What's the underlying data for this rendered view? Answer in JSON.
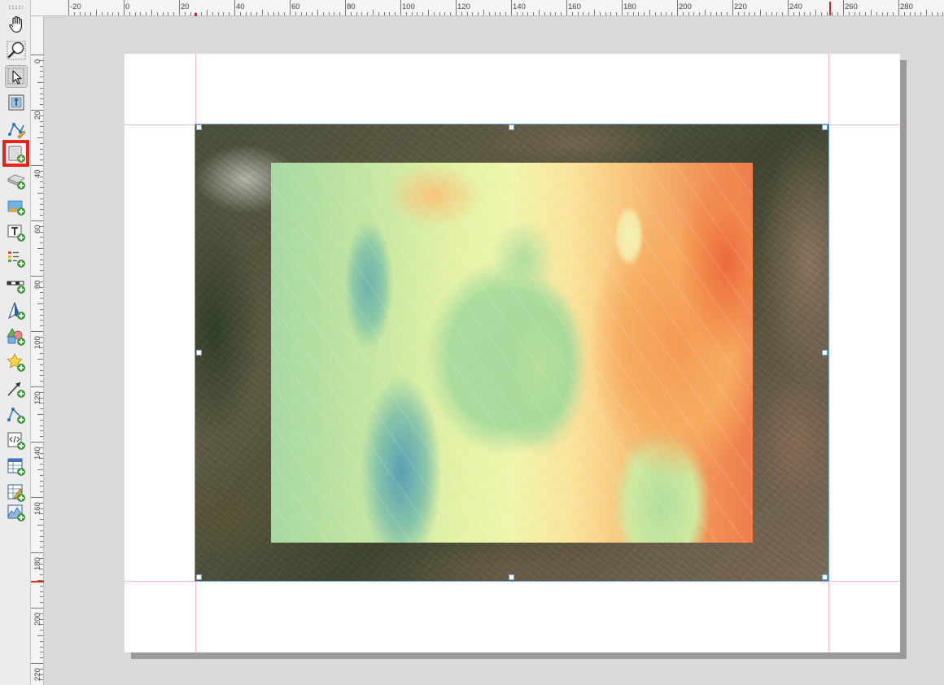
{
  "window": {
    "app": "Print layout designer"
  },
  "toolbar": {
    "tools": [
      {
        "id": "pan",
        "icon": "hand-pan-icon",
        "tooltip": "Pan Layout"
      },
      {
        "id": "zoom",
        "icon": "zoom-magnifier-icon",
        "tooltip": "Zoom"
      },
      {
        "id": "select",
        "icon": "select-move-arrow-icon",
        "tooltip": "Select/Move Item",
        "active": true
      },
      {
        "id": "move-content",
        "icon": "move-item-content-icon",
        "tooltip": "Move Item Content"
      },
      {
        "id": "edit-nodes",
        "icon": "edit-nodes-icon",
        "tooltip": "Edit Nodes Item"
      },
      {
        "id": "add-map",
        "icon": "add-map-icon",
        "tooltip": "Add Map",
        "highlighted": true
      },
      {
        "id": "add-3d-map",
        "icon": "add-3d-map-icon",
        "tooltip": "Add 3D Map"
      },
      {
        "id": "add-picture",
        "icon": "add-picture-icon",
        "tooltip": "Add Picture"
      },
      {
        "id": "add-label",
        "icon": "add-label-icon",
        "tooltip": "Add Label"
      },
      {
        "id": "add-legend",
        "icon": "add-legend-icon",
        "tooltip": "Add Legend"
      },
      {
        "id": "add-scale-bar",
        "icon": "add-scale-bar-icon",
        "tooltip": "Add Scale Bar"
      },
      {
        "id": "add-north-arrow",
        "icon": "add-north-arrow-icon",
        "tooltip": "Add North Arrow"
      },
      {
        "id": "add-shape",
        "icon": "add-shape-icon",
        "tooltip": "Add Shape"
      },
      {
        "id": "add-marker",
        "icon": "add-marker-star-icon",
        "tooltip": "Add Marker"
      },
      {
        "id": "add-arrow",
        "icon": "add-arrow-icon",
        "tooltip": "Add Arrow"
      },
      {
        "id": "add-node-item",
        "icon": "add-node-item-icon",
        "tooltip": "Add Node Item"
      },
      {
        "id": "add-html",
        "icon": "add-html-icon",
        "tooltip": "Add HTML"
      },
      {
        "id": "add-attribute-table",
        "icon": "add-attribute-table-icon",
        "tooltip": "Add Attribute Table"
      },
      {
        "id": "add-fixed-table",
        "icon": "add-fixed-table-icon",
        "tooltip": "Add Fixed Table"
      },
      {
        "id": "add-elevation-profile",
        "icon": "add-elevation-profile-icon",
        "tooltip": "Add Elevation Profile"
      }
    ]
  },
  "ruler_top": {
    "labels": [
      "-20",
      "0",
      "20",
      "40",
      "60",
      "80",
      "100",
      "120",
      "140",
      "160",
      "180",
      "200",
      "220",
      "240",
      "260",
      "280"
    ]
  },
  "ruler_left": {
    "labels": [
      "0",
      "20",
      "40",
      "60",
      "80",
      "100",
      "120",
      "140",
      "160",
      "180",
      "200",
      "220"
    ]
  },
  "canvas": {
    "page": {
      "color": "#ffffff"
    },
    "map_item": {
      "basemap": "satellite-imagery",
      "overlay": "temperature-raster",
      "selected": true,
      "raster_colormap": [
        "#2c7bb6",
        "#abd9e9",
        "#ffffbf",
        "#fdae61",
        "#d7191c"
      ]
    }
  },
  "colors": {
    "highlight": "#e8231b",
    "selection": "#6aa6d6",
    "guides": "#ff8fa0"
  }
}
